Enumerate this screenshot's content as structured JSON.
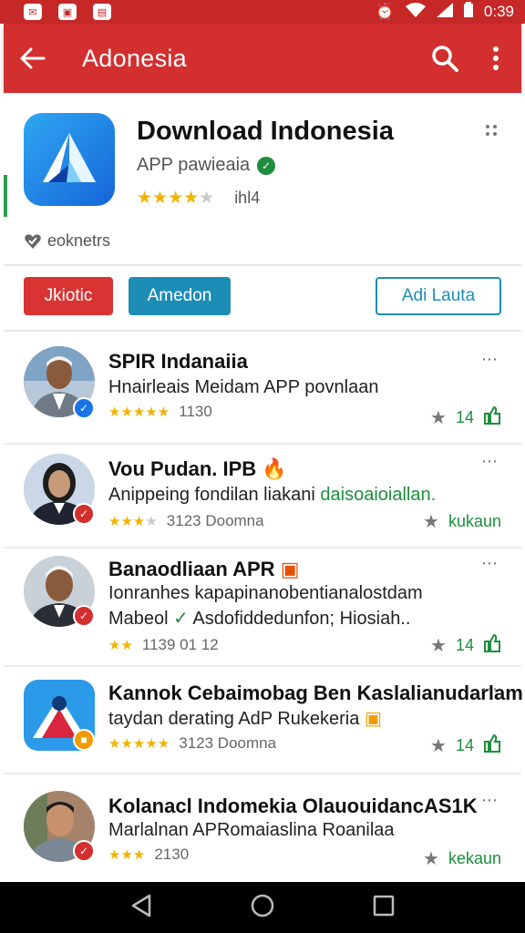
{
  "status_bar": {
    "time": "0:39"
  },
  "toolbar": {
    "title": "Adonesia"
  },
  "app": {
    "title": "Download Indonesia",
    "subtitle": "APP pawieaia",
    "rating_count": "ihl4",
    "security_label": "eoknetrs",
    "rating": 3.5,
    "colors": {
      "brand": "#d32f2f",
      "accent": "#1e8db5",
      "green": "#1e8e3e"
    }
  },
  "actions": {
    "primary": "Jkiotic",
    "secondary": "Amedon",
    "outline": "Adi Lauta"
  },
  "items": [
    {
      "title": "SPIR Indanaiia",
      "line1": "Hnairleais Meidam APP povnlaan",
      "rating_text": "1130",
      "right": "14",
      "badge": "blue"
    },
    {
      "title": "Vou Pudan. IPB",
      "line1": "Anippeing fondilan liakani",
      "line1_green": "daisoaioiallan.",
      "rating_text": "3123 Doomna",
      "right": "kukaun",
      "badge": "red"
    },
    {
      "title": "Banaodliaan APR",
      "line1": "Ionranhes kapapinanobentianalostdam",
      "line2": "Mabeol",
      "line2_rest": "Asdofiddedunfon; Hiosiah..",
      "rating_text": "1139 01 12",
      "right": "14",
      "badge": "red"
    },
    {
      "title": "Kannok Cebaimobag Ben Kaslalianudarlam",
      "line1": "taydan derating AdP Rukekeria",
      "rating_text": "3123 Doomna",
      "right": "14",
      "badge": "orange"
    },
    {
      "title": "Kolanacl Indomekia OlauouidancAS1K",
      "line1": "Marlalnan APRomaiaslina Roanilaa",
      "rating_text": "2130",
      "right": "kekaun",
      "badge": "red"
    }
  ]
}
